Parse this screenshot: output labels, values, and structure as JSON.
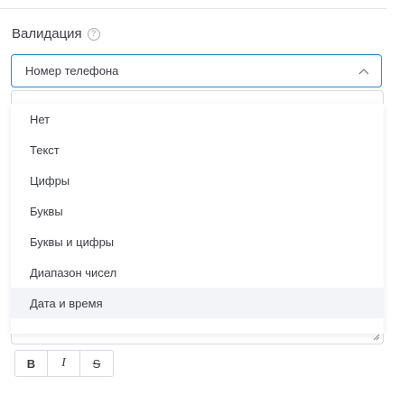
{
  "validation": {
    "label": "Валидация",
    "help_symbol": "?",
    "selected_value": "Номер телефона",
    "options": [
      {
        "label": "Нет"
      },
      {
        "label": "Текст"
      },
      {
        "label": "Цифры"
      },
      {
        "label": "Буквы"
      },
      {
        "label": "Буквы и цифры"
      },
      {
        "label": "Диапазон чисел"
      },
      {
        "label": "Дата и время",
        "highlighted": true
      }
    ]
  },
  "toolbar": {
    "bold_label": "B",
    "italic_label": "I",
    "strike_label": "S"
  },
  "colors": {
    "accent": "#1f8fd8",
    "hover_bg": "#f2f4f7",
    "border": "#d6d9de"
  },
  "icons": [
    "help-circle-icon",
    "chevron-up-icon",
    "resize-grip-icon"
  ]
}
